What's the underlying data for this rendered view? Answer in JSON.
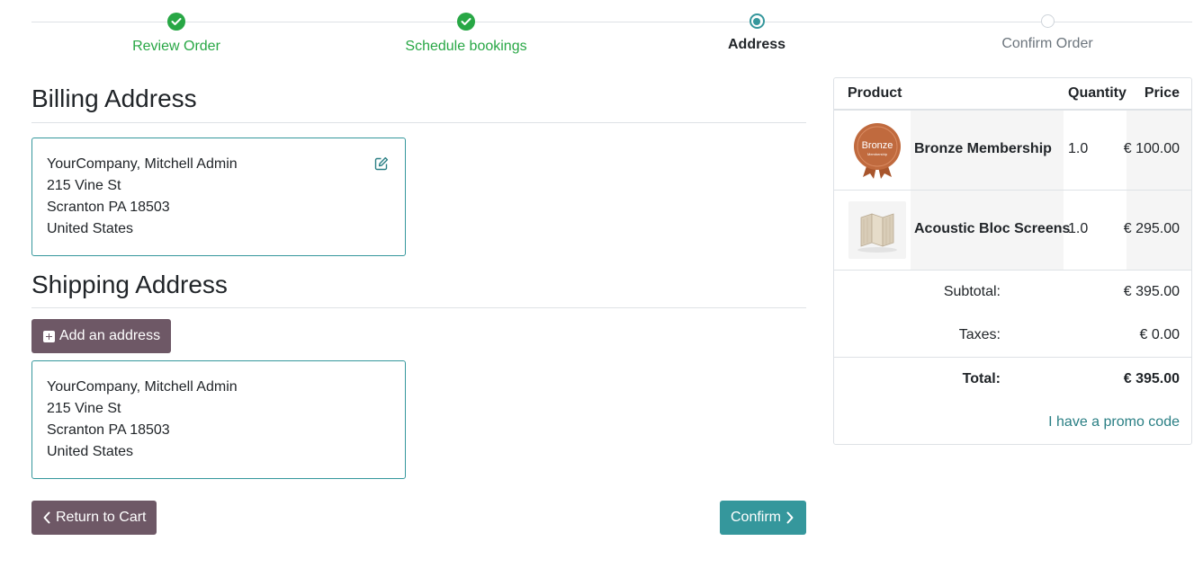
{
  "steps": [
    {
      "label": "Review Order",
      "state": "done"
    },
    {
      "label": "Schedule bookings",
      "state": "done"
    },
    {
      "label": "Address",
      "state": "current"
    },
    {
      "label": "Confirm Order",
      "state": "todo"
    }
  ],
  "billing": {
    "title": "Billing Address",
    "lines": [
      "YourCompany, Mitchell Admin",
      "215 Vine St",
      "Scranton PA 18503",
      "United States"
    ]
  },
  "shipping": {
    "title": "Shipping Address",
    "add_label": "Add an address",
    "lines": [
      "YourCompany, Mitchell Admin",
      "215 Vine St",
      "Scranton PA 18503",
      "United States"
    ]
  },
  "buttons": {
    "return_label": "Return to Cart",
    "confirm_label": "Confirm"
  },
  "summary": {
    "headers": {
      "product": "Product",
      "quantity": "Quantity",
      "price": "Price"
    },
    "items": [
      {
        "name": "Bronze Membership",
        "quantity": "1.0",
        "price": "€ 100.00",
        "badge": "Bronze",
        "badge_sub": "Membership"
      },
      {
        "name": "Acoustic Bloc Screens",
        "quantity": "1.0",
        "price": "€ 295.00"
      }
    ],
    "subtotal_label": "Subtotal:",
    "subtotal": "€ 395.00",
    "taxes_label": "Taxes:",
    "taxes": "€ 0.00",
    "total_label": "Total:",
    "total": "€ 395.00",
    "promo_label": "I have a promo code"
  },
  "colors": {
    "success": "#28a745",
    "primary": "#35979c",
    "secondary": "#6e5866",
    "bronze": "#c06a3e"
  }
}
